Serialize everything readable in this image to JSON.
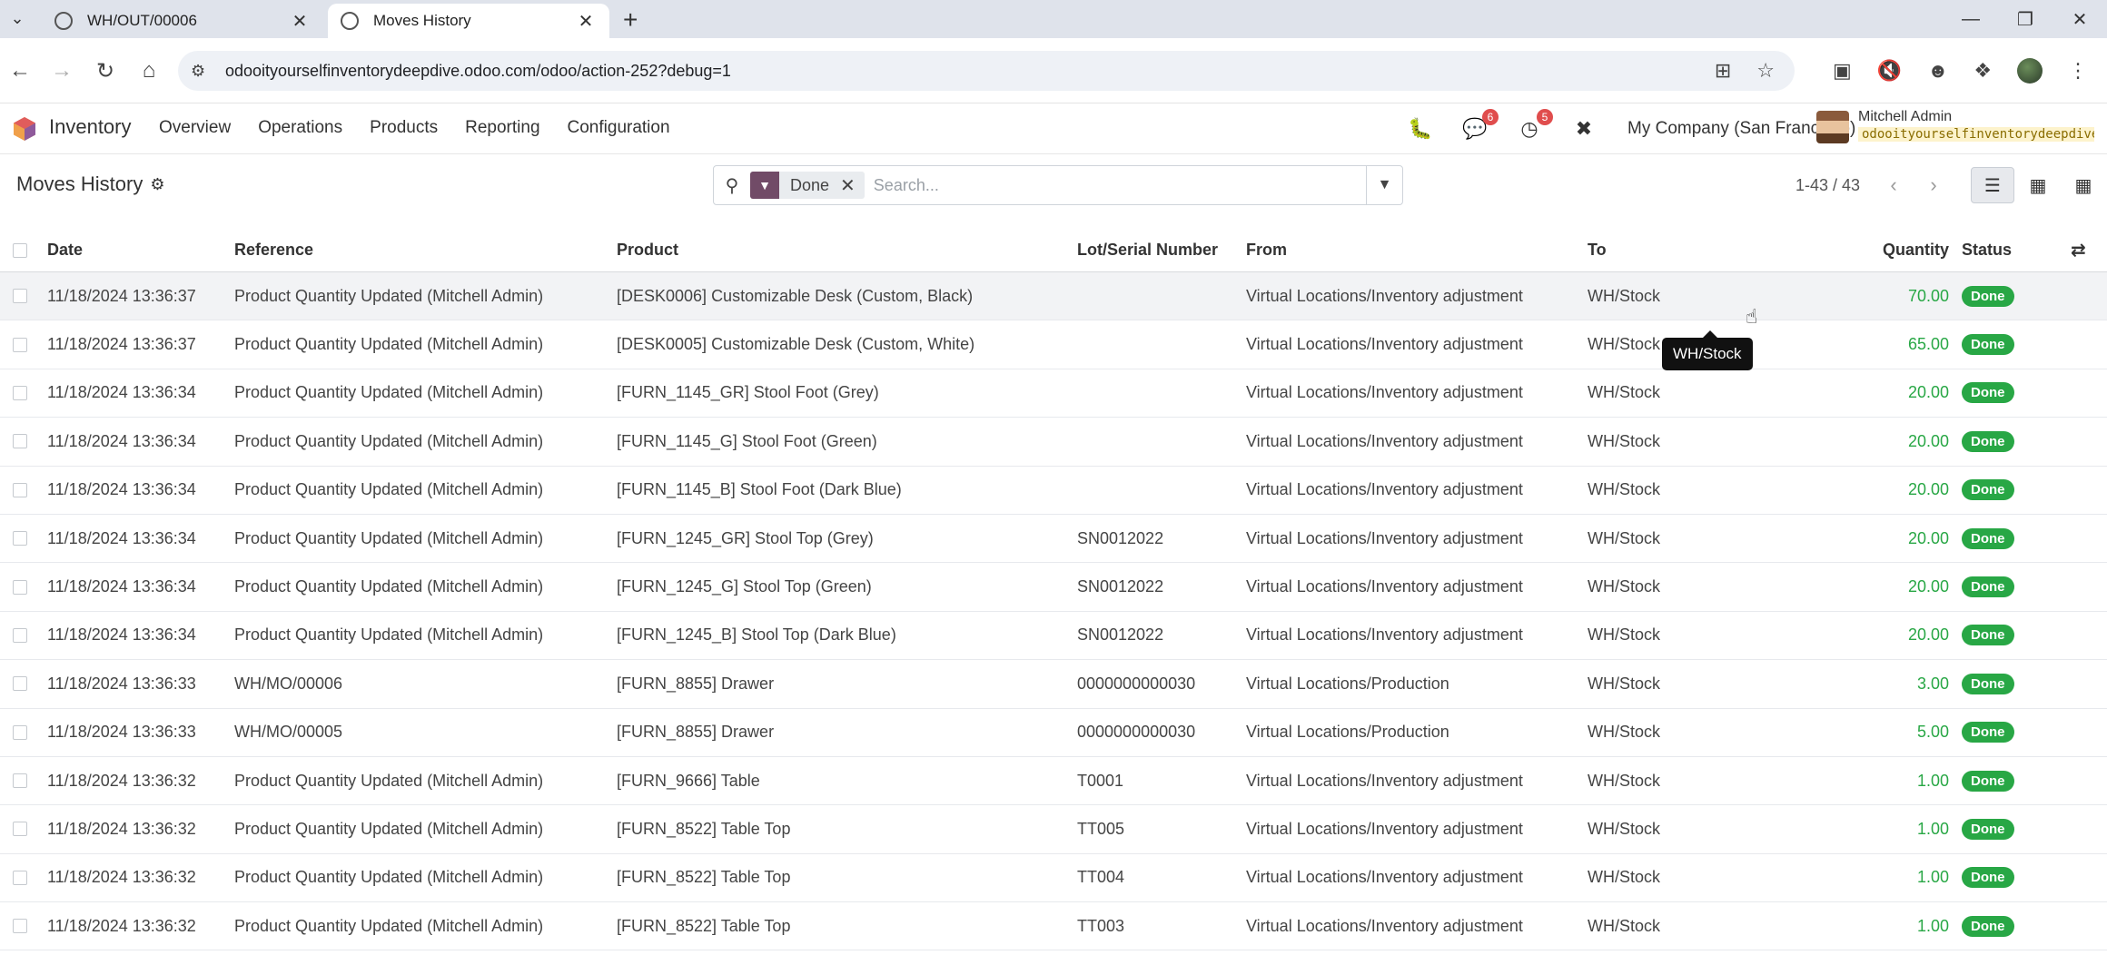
{
  "browser": {
    "tabs": [
      {
        "title": "WH/OUT/00006",
        "active": false
      },
      {
        "title": "Moves History",
        "active": true
      }
    ],
    "url": "odooityourselfinventorydeepdive.odoo.com/odoo/action-252?debug=1"
  },
  "navbar": {
    "app_name": "Inventory",
    "menu": [
      "Overview",
      "Operations",
      "Products",
      "Reporting",
      "Configuration"
    ],
    "messages_count": "6",
    "activities_count": "5",
    "company": "My Company (San Francisco)",
    "user_name": "Mitchell Admin",
    "db_name": "odooityourselfinventorydeepdive"
  },
  "control": {
    "title": "Moves History",
    "facet_label": "Done",
    "search_placeholder": "Search...",
    "pager": "1-43 / 43"
  },
  "table": {
    "headers": {
      "date": "Date",
      "reference": "Reference",
      "product": "Product",
      "lot": "Lot/Serial Number",
      "from": "From",
      "to": "To",
      "quantity": "Quantity",
      "status": "Status"
    },
    "rows": [
      {
        "date": "11/18/2024 13:36:37",
        "reference": "Product Quantity Updated (Mitchell Admin)",
        "product": "[DESK0006] Customizable Desk (Custom, Black)",
        "lot": "",
        "from": "Virtual Locations/Inventory adjustment",
        "to": "WH/Stock",
        "quantity": "70.00",
        "status": "Done"
      },
      {
        "date": "11/18/2024 13:36:37",
        "reference": "Product Quantity Updated (Mitchell Admin)",
        "product": "[DESK0005] Customizable Desk (Custom, White)",
        "lot": "",
        "from": "Virtual Locations/Inventory adjustment",
        "to": "WH/Stock",
        "quantity": "65.00",
        "status": "Done"
      },
      {
        "date": "11/18/2024 13:36:34",
        "reference": "Product Quantity Updated (Mitchell Admin)",
        "product": "[FURN_1145_GR] Stool Foot (Grey)",
        "lot": "",
        "from": "Virtual Locations/Inventory adjustment",
        "to": "WH/Stock",
        "quantity": "20.00",
        "status": "Done"
      },
      {
        "date": "11/18/2024 13:36:34",
        "reference": "Product Quantity Updated (Mitchell Admin)",
        "product": "[FURN_1145_G] Stool Foot (Green)",
        "lot": "",
        "from": "Virtual Locations/Inventory adjustment",
        "to": "WH/Stock",
        "quantity": "20.00",
        "status": "Done"
      },
      {
        "date": "11/18/2024 13:36:34",
        "reference": "Product Quantity Updated (Mitchell Admin)",
        "product": "[FURN_1145_B] Stool Foot (Dark Blue)",
        "lot": "",
        "from": "Virtual Locations/Inventory adjustment",
        "to": "WH/Stock",
        "quantity": "20.00",
        "status": "Done"
      },
      {
        "date": "11/18/2024 13:36:34",
        "reference": "Product Quantity Updated (Mitchell Admin)",
        "product": "[FURN_1245_GR] Stool Top (Grey)",
        "lot": "SN0012022",
        "from": "Virtual Locations/Inventory adjustment",
        "to": "WH/Stock",
        "quantity": "20.00",
        "status": "Done"
      },
      {
        "date": "11/18/2024 13:36:34",
        "reference": "Product Quantity Updated (Mitchell Admin)",
        "product": "[FURN_1245_G] Stool Top (Green)",
        "lot": "SN0012022",
        "from": "Virtual Locations/Inventory adjustment",
        "to": "WH/Stock",
        "quantity": "20.00",
        "status": "Done"
      },
      {
        "date": "11/18/2024 13:36:34",
        "reference": "Product Quantity Updated (Mitchell Admin)",
        "product": "[FURN_1245_B] Stool Top (Dark Blue)",
        "lot": "SN0012022",
        "from": "Virtual Locations/Inventory adjustment",
        "to": "WH/Stock",
        "quantity": "20.00",
        "status": "Done"
      },
      {
        "date": "11/18/2024 13:36:33",
        "reference": "WH/MO/00006",
        "product": "[FURN_8855] Drawer",
        "lot": "0000000000030",
        "from": "Virtual Locations/Production",
        "to": "WH/Stock",
        "quantity": "3.00",
        "status": "Done"
      },
      {
        "date": "11/18/2024 13:36:33",
        "reference": "WH/MO/00005",
        "product": "[FURN_8855] Drawer",
        "lot": "0000000000030",
        "from": "Virtual Locations/Production",
        "to": "WH/Stock",
        "quantity": "5.00",
        "status": "Done"
      },
      {
        "date": "11/18/2024 13:36:32",
        "reference": "Product Quantity Updated (Mitchell Admin)",
        "product": "[FURN_9666] Table",
        "lot": "T0001",
        "from": "Virtual Locations/Inventory adjustment",
        "to": "WH/Stock",
        "quantity": "1.00",
        "status": "Done"
      },
      {
        "date": "11/18/2024 13:36:32",
        "reference": "Product Quantity Updated (Mitchell Admin)",
        "product": "[FURN_8522] Table Top",
        "lot": "TT005",
        "from": "Virtual Locations/Inventory adjustment",
        "to": "WH/Stock",
        "quantity": "1.00",
        "status": "Done"
      },
      {
        "date": "11/18/2024 13:36:32",
        "reference": "Product Quantity Updated (Mitchell Admin)",
        "product": "[FURN_8522] Table Top",
        "lot": "TT004",
        "from": "Virtual Locations/Inventory adjustment",
        "to": "WH/Stock",
        "quantity": "1.00",
        "status": "Done"
      },
      {
        "date": "11/18/2024 13:36:32",
        "reference": "Product Quantity Updated (Mitchell Admin)",
        "product": "[FURN_8522] Table Top",
        "lot": "TT003",
        "from": "Virtual Locations/Inventory adjustment",
        "to": "WH/Stock",
        "quantity": "1.00",
        "status": "Done"
      }
    ]
  },
  "tooltip": "WH/Stock",
  "colors": {
    "brand": "#714b67",
    "done_green": "#28a745",
    "badge_red": "#e04d4d"
  }
}
